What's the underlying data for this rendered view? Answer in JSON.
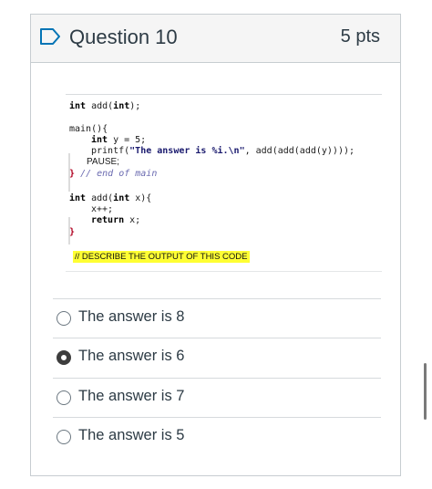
{
  "question": {
    "title": "Question 10",
    "points": "5 pts"
  },
  "code": {
    "lines": [
      "int add(int);",
      "main(){",
      "int y = 5;",
      "printf(\"The answer is %i.\\n\", add(add(add(y))));",
      "PAUSE;",
      "} // end of main",
      "int add(int x){",
      "x++;",
      "return x;",
      "}"
    ],
    "comment": "// DESCRIBE THE OUTPUT OF THIS CODE"
  },
  "answers": [
    {
      "label": "The answer is 8",
      "selected": false
    },
    {
      "label": "The answer is 6",
      "selected": true
    },
    {
      "label": "The answer is 7",
      "selected": false
    },
    {
      "label": "The answer is 5",
      "selected": false
    }
  ]
}
